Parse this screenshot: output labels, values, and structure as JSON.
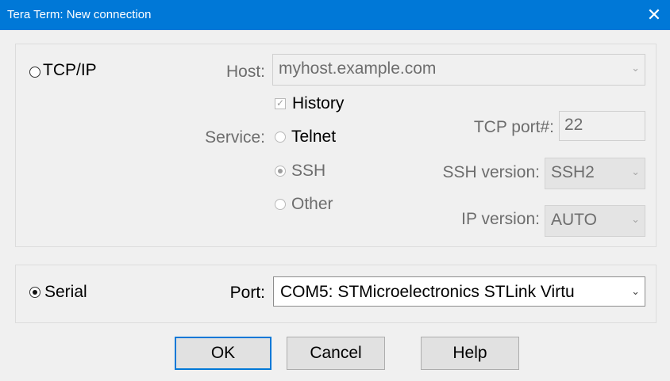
{
  "window": {
    "title": "Tera Term: New connection",
    "close_glyph": "✕"
  },
  "tcpip": {
    "radio_label": "TCP/IP",
    "selected": false,
    "host_label": "Host:",
    "host_value": "myhost.example.com",
    "history_label": "History",
    "history_checked": true,
    "service_label": "Service:",
    "services": [
      {
        "label": "Telnet",
        "selected": false
      },
      {
        "label": "SSH",
        "selected": true
      },
      {
        "label": "Other",
        "selected": false
      }
    ],
    "tcp_port_label": "TCP port#:",
    "tcp_port_value": "22",
    "ssh_version_label": "SSH version:",
    "ssh_version_value": "SSH2",
    "ip_version_label": "IP version:",
    "ip_version_value": "AUTO"
  },
  "serial": {
    "radio_label": "Serial",
    "selected": true,
    "port_label": "Port:",
    "port_value": "COM5: STMicroelectronics STLink Virtu"
  },
  "buttons": {
    "ok": "OK",
    "cancel": "Cancel",
    "help": "Help"
  },
  "icons": {
    "dropdown": "chevron-down-icon",
    "close": "close-icon",
    "check": "checkmark-icon"
  },
  "colors": {
    "titlebar": "#0078d7",
    "default_button_border": "#0078d7"
  }
}
